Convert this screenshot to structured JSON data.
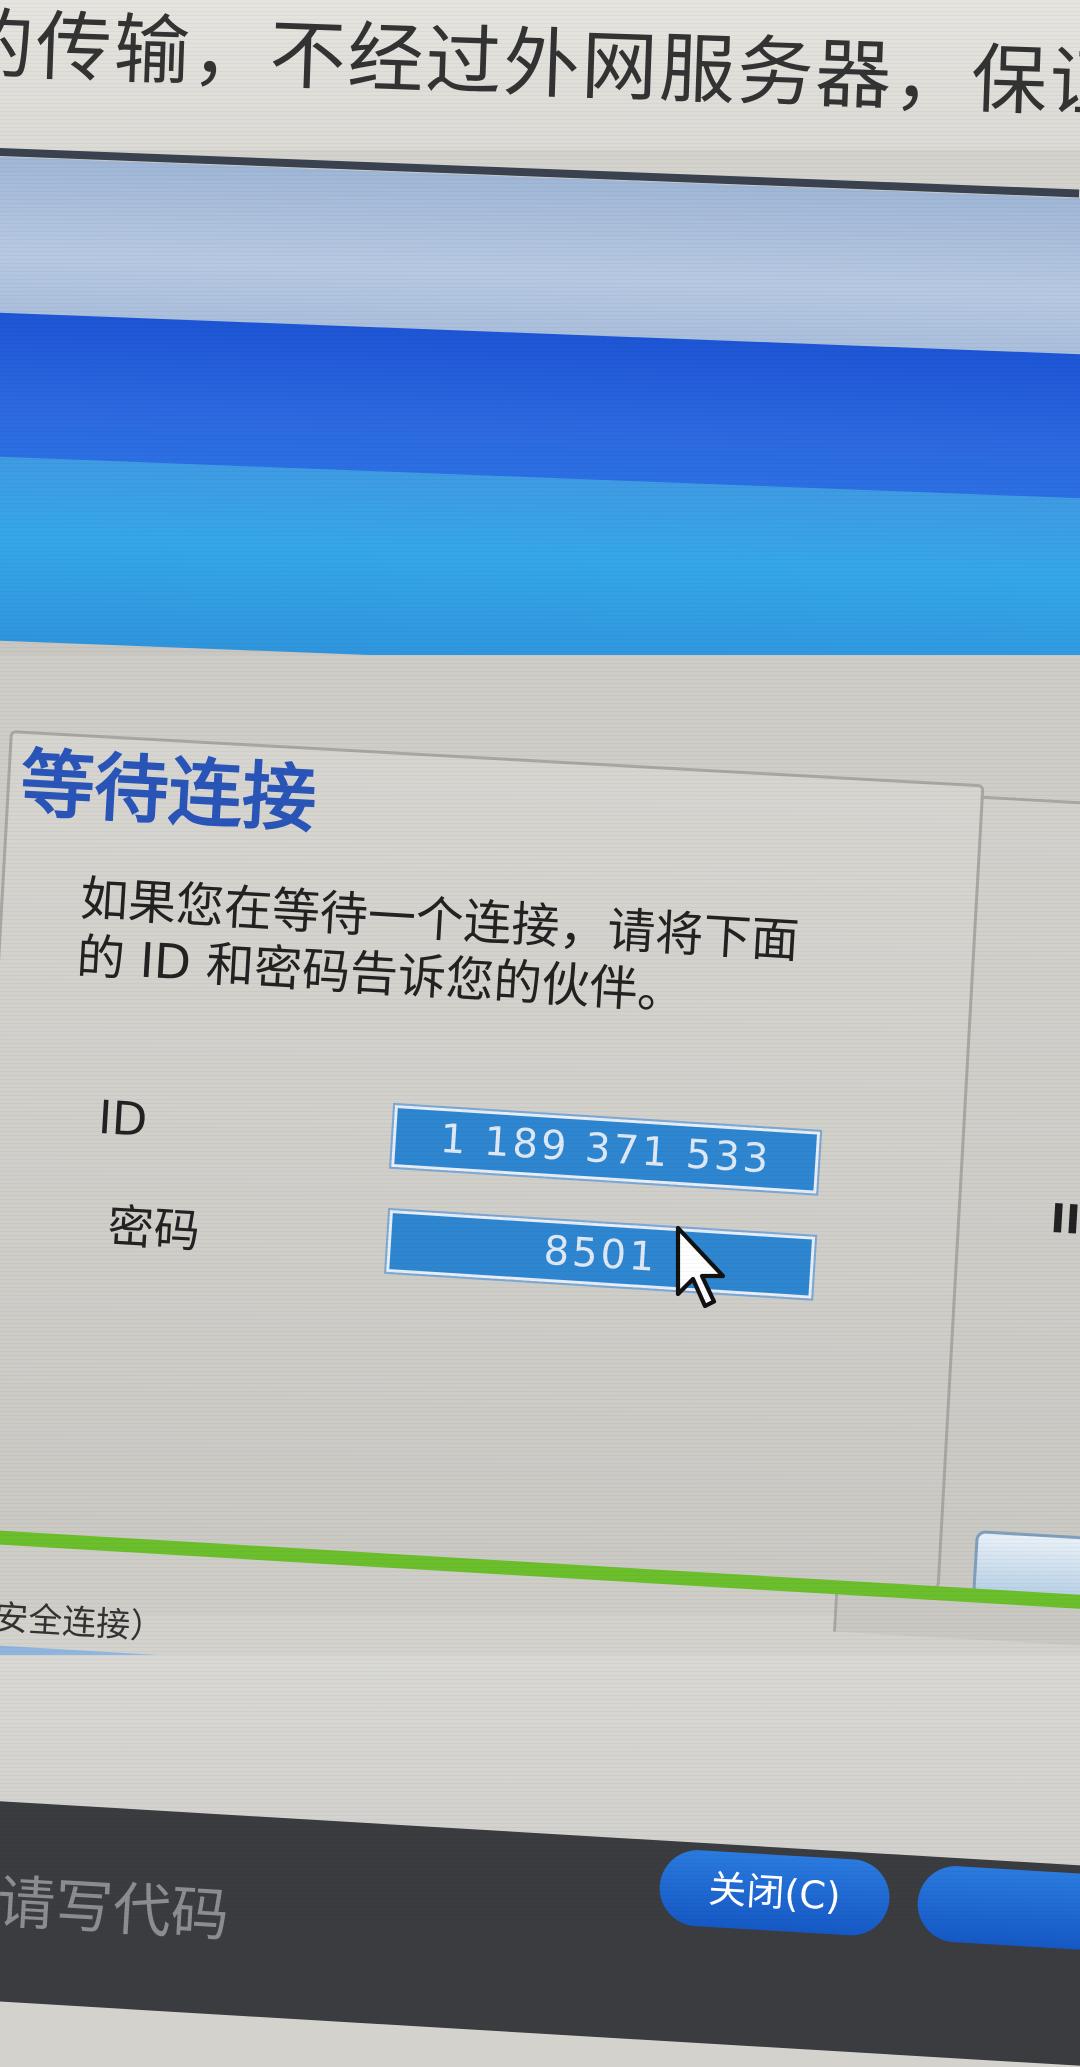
{
  "top_text": "的传输，不经过外网服务器，保证",
  "panel": {
    "title": "等待连接",
    "instructions": "如果您在等待一个连接，请将下面的 ID 和密码告诉您的伙伴。",
    "id_label": "ID",
    "id_value": "1 189 371 533",
    "password_label": "密码",
    "password_value": "8501"
  },
  "right_panel": {
    "label": "II"
  },
  "status": {
    "text": "安全连接）"
  },
  "footer": {
    "text": "请写代码",
    "close_label": "关闭(C)"
  },
  "colors": {
    "title_blue": "#2a55b8",
    "field_blue": "#2f86d0",
    "status_green": "#6cbf2c",
    "button_blue": "#1558c4"
  },
  "icons": {
    "cursor": "mouse-pointer-icon"
  }
}
